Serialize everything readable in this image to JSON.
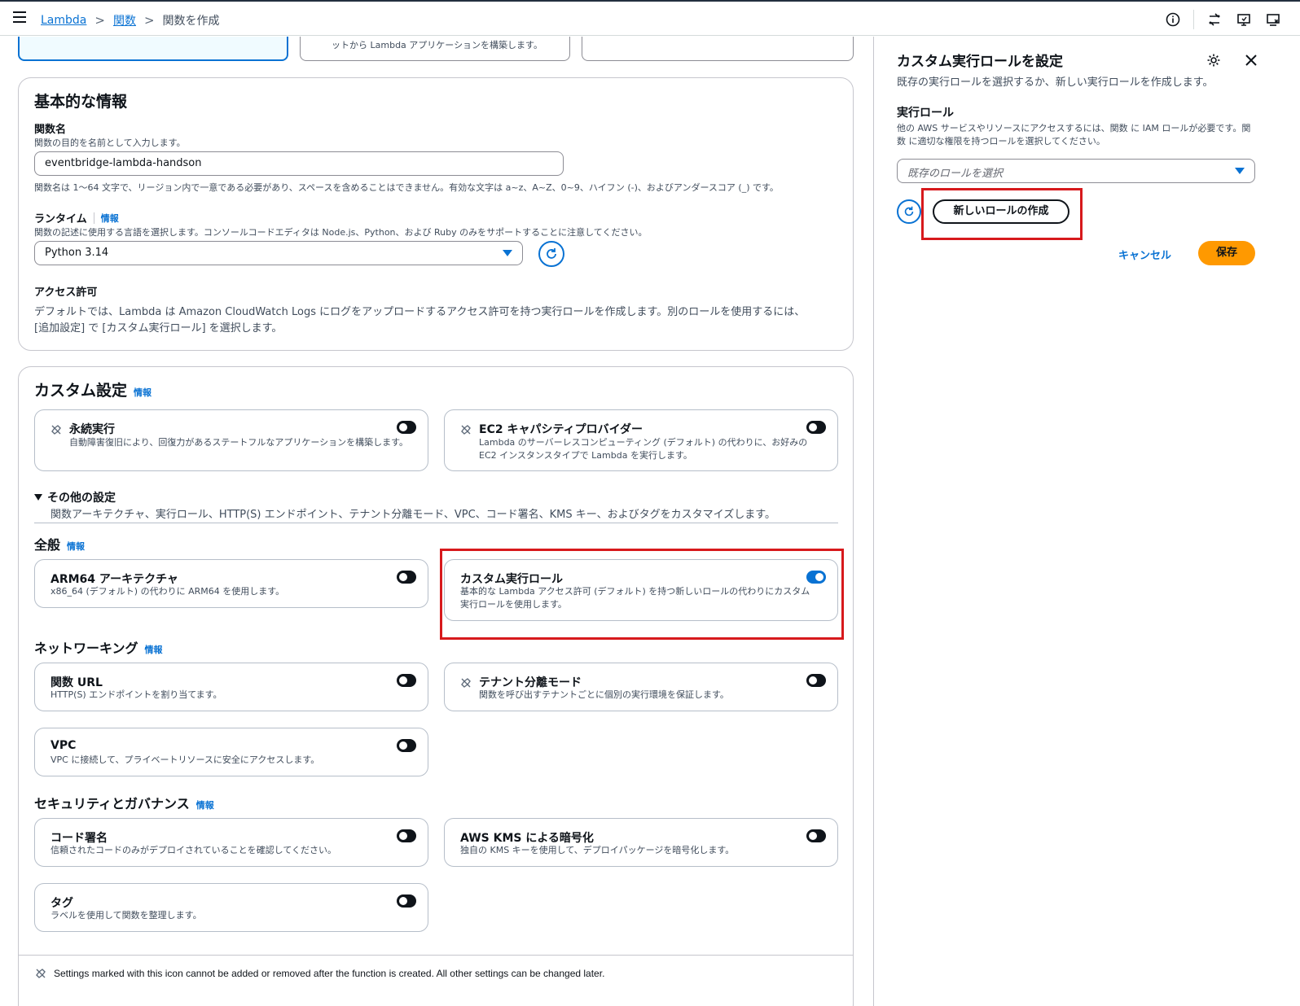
{
  "breadcrumb": {
    "items": [
      "Lambda",
      "関数"
    ],
    "current": "関数を作成"
  },
  "tiles": {
    "middle_text": "ットから Lambda アプリケーションを構築します。"
  },
  "basic": {
    "title": "基本的な情報",
    "function_name_label": "関数名",
    "function_name_desc": "関数の目的を名前として入力します。",
    "function_name_value": "eventbridge-lambda-handson",
    "function_name_hint": "関数名は 1〜64 文字で、リージョン内で一意である必要があり、スペースを含めることはできません。有効な文字は a~z、A~Z、0~9、ハイフン (-)、およびアンダースコア (_) です。",
    "runtime_label": "ランタイム",
    "runtime_info": "情報",
    "runtime_desc": "関数の記述に使用する言語を選択します。コンソールコードエディタは Node.js、Python、および Ruby のみをサポートすることに注意してください。",
    "runtime_value": "Python 3.14",
    "access_label": "アクセス許可",
    "access_line1": "デフォルトでは、Lambda は Amazon CloudWatch Logs にログをアップロードするアクセス許可を持つ実行ロールを作成します。別のロールを使用するには、",
    "access_line2": "[追加設定] で [カスタム実行ロール] を選択します。"
  },
  "custom": {
    "title": "カスタム設定",
    "info": "情報",
    "durable_title": "永続実行",
    "durable_desc": "自動障害復旧により、回復力があるステートフルなアプリケーションを構築します。",
    "ec2_title": "EC2 キャパシティプロバイダー",
    "ec2_desc": "Lambda のサーバーレスコンピューティング (デフォルト) の代わりに、お好みの EC2 インスタンスタイプで Lambda を実行します。",
    "other_title": "その他の設定",
    "other_desc": "関数アーキテクチャ、実行ロール、HTTP(S) エンドポイント、テナント分離モード、VPC、コード署名、KMS キー、およびタグをカスタマイズします。",
    "general_title": "全般",
    "general_info": "情報",
    "arm_title": "ARM64 アーキテクチャ",
    "arm_desc": "x86_64 (デフォルト) の代わりに ARM64 を使用します。",
    "role_title": "カスタム実行ロール",
    "role_desc": "基本的な Lambda アクセス許可 (デフォルト) を持つ新しいロールの代わりにカスタム実行ロールを使用します。",
    "net_title": "ネットワーキング",
    "net_info": "情報",
    "url_title": "関数 URL",
    "url_desc": "HTTP(S) エンドポイントを割り当てます。",
    "tenant_title": "テナント分離モード",
    "tenant_desc": "関数を呼び出すテナントごとに個別の実行環境を保証します。",
    "vpc_title": "VPC",
    "vpc_desc": "VPC に接続して、プライベートリソースに安全にアクセスします。",
    "sec_title": "セキュリティとガバナンス",
    "sec_info": "情報",
    "sign_title": "コード署名",
    "sign_desc": "信頼されたコードのみがデプロイされていることを確認してください。",
    "kms_title": "AWS KMS による暗号化",
    "kms_desc": "独自の KMS キーを使用して、デプロイパッケージを暗号化します。",
    "tag_title": "タグ",
    "tag_desc": "ラベルを使用して関数を整理します。",
    "footer_note": "Settings marked with this icon cannot be added or removed after the function is created. All other settings can be changed later."
  },
  "side": {
    "title": "カスタム実行ロールを設定",
    "subtitle": "既存の実行ロールを選択するか、新しい実行ロールを作成します。",
    "role_label": "実行ロール",
    "role_desc": "他の AWS サービスやリソースにアクセスするには、関数 に IAM ロールが必要です。関数 に適切な権限を持つロールを選択してください。",
    "select_placeholder": "既存のロールを選択",
    "create_button": "新しいロールの作成",
    "cancel_button": "キャンセル",
    "save_button": "保存"
  },
  "colors": {
    "accent": "#0972d3",
    "primary_button": "#ff9900",
    "highlight": "#d7191c"
  }
}
